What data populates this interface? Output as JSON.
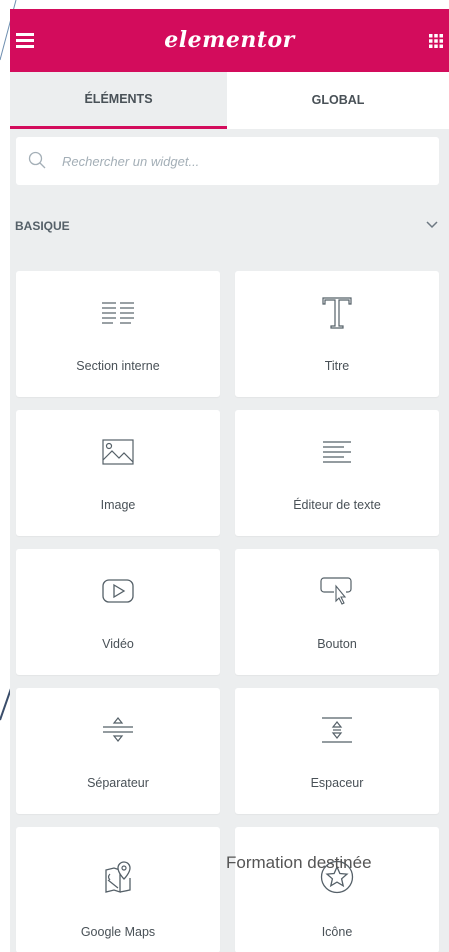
{
  "app": {
    "logo": "elementor",
    "brand_color": "#d30c5c"
  },
  "tabs": [
    {
      "label": "ÉLÉMENTS",
      "active": true
    },
    {
      "label": "GLOBAL",
      "active": false
    }
  ],
  "search": {
    "placeholder": "Rechercher un widget..."
  },
  "section": {
    "title": "BASIQUE",
    "expanded": true
  },
  "widgets": [
    {
      "label": "Section interne",
      "icon": "inner-section-icon"
    },
    {
      "label": "Titre",
      "icon": "heading-icon"
    },
    {
      "label": "Image",
      "icon": "image-icon"
    },
    {
      "label": "Éditeur de texte",
      "icon": "text-editor-icon"
    },
    {
      "label": "Vidéo",
      "icon": "video-icon"
    },
    {
      "label": "Bouton",
      "icon": "button-icon"
    },
    {
      "label": "Séparateur",
      "icon": "divider-icon"
    },
    {
      "label": "Espaceur",
      "icon": "spacer-icon"
    },
    {
      "label": "Google Maps",
      "icon": "google-maps-icon"
    },
    {
      "label": "Icône",
      "icon": "star-icon"
    }
  ],
  "overlay_text": "Formation destinée"
}
